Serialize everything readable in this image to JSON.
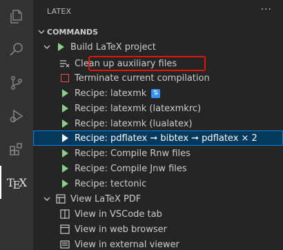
{
  "activity_bar": {
    "items": [
      {
        "name": "explorer-icon"
      },
      {
        "name": "search-icon"
      },
      {
        "name": "source-control-icon"
      },
      {
        "name": "run-debug-icon"
      },
      {
        "name": "extensions-icon"
      },
      {
        "name": "latex-workshop-icon",
        "label": "TeX",
        "active": true
      }
    ]
  },
  "panel": {
    "title": "LATEX",
    "more_icon": "ellipsis-icon"
  },
  "tree": {
    "section_label": "COMMANDS",
    "build": {
      "label": "Build LaTeX project",
      "items": [
        {
          "label": "Clean up auxiliary files",
          "icon": "clear-all-icon",
          "highlighted": true
        },
        {
          "label": "Terminate current compilation",
          "icon": "stop-icon"
        },
        {
          "label": "Recipe: latexmk",
          "icon": "play-icon",
          "badge": "refresh-badge-icon"
        },
        {
          "label": "Recipe: latexmk (latexmkrc)",
          "icon": "play-icon"
        },
        {
          "label": "Recipe: latexmk (lualatex)",
          "icon": "play-icon"
        },
        {
          "label": "Recipe: pdflatex ➞ bibtex ➞ pdflatex × 2",
          "icon": "play-icon",
          "selected": true
        },
        {
          "label": "Recipe: Compile Rnw files",
          "icon": "play-icon"
        },
        {
          "label": "Recipe: Compile Jnw files",
          "icon": "play-icon"
        },
        {
          "label": "Recipe: tectonic",
          "icon": "play-icon"
        }
      ]
    },
    "view": {
      "label": "View LaTeX PDF",
      "items": [
        {
          "label": "View in VSCode tab",
          "icon": "vscode-tab-icon"
        },
        {
          "label": "View in web browser",
          "icon": "browser-icon"
        },
        {
          "label": "View in external viewer",
          "icon": "external-viewer-icon"
        }
      ]
    }
  },
  "colors": {
    "accent_selection": "#04395e",
    "focus_border": "#007fd4",
    "play_green": "#89d185",
    "stop_red": "#f14c4c",
    "highlight_red": "#e51400"
  }
}
